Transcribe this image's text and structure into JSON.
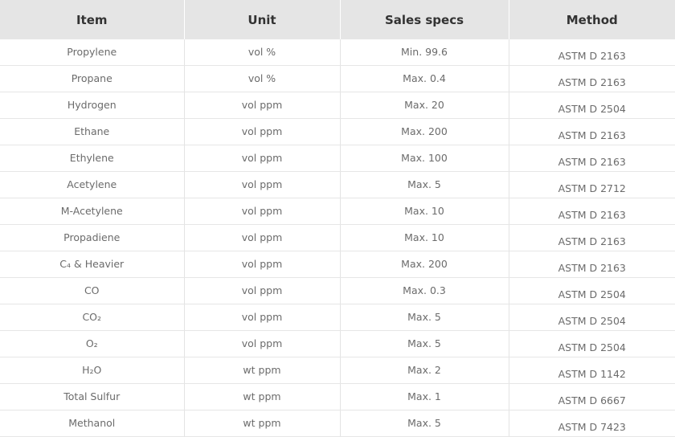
{
  "table": {
    "headers": [
      "Item",
      "Unit",
      "Sales specs",
      "Method"
    ],
    "rows": [
      {
        "item": "Propylene",
        "unit": "vol %",
        "spec": "Min. 99.6",
        "method": "ASTM D 2163"
      },
      {
        "item": "Propane",
        "unit": "vol %",
        "spec": "Max. 0.4",
        "method": "ASTM D 2163"
      },
      {
        "item": "Hydrogen",
        "unit": "vol ppm",
        "spec": "Max. 20",
        "method": "ASTM D 2504"
      },
      {
        "item": "Ethane",
        "unit": "vol ppm",
        "spec": "Max. 200",
        "method": "ASTM D 2163"
      },
      {
        "item": "Ethylene",
        "unit": "vol ppm",
        "spec": "Max. 100",
        "method": "ASTM D 2163"
      },
      {
        "item": "Acetylene",
        "unit": "vol ppm",
        "spec": "Max. 5",
        "method": "ASTM D 2712"
      },
      {
        "item": "M-Acetylene",
        "unit": "vol ppm",
        "spec": "Max. 10",
        "method": "ASTM D 2163"
      },
      {
        "item": "Propadiene",
        "unit": "vol ppm",
        "spec": "Max. 10",
        "method": "ASTM D 2163"
      },
      {
        "item": "C₄ & Heavier",
        "unit": "vol ppm",
        "spec": "Max. 200",
        "method": "ASTM D 2163"
      },
      {
        "item": "CO",
        "unit": "vol ppm",
        "spec": "Max. 0.3",
        "method": "ASTM D 2504"
      },
      {
        "item": "CO₂",
        "unit": "vol ppm",
        "spec": "Max. 5",
        "method": "ASTM D 2504"
      },
      {
        "item": "O₂",
        "unit": "vol ppm",
        "spec": "Max. 5",
        "method": "ASTM D 2504"
      },
      {
        "item": "H₂O",
        "unit": "wt ppm",
        "spec": "Max. 2",
        "method": "ASTM D 1142"
      },
      {
        "item": "Total Sulfur",
        "unit": "wt ppm",
        "spec": "Max. 1",
        "method": "ASTM D 6667"
      },
      {
        "item": "Methanol",
        "unit": "wt ppm",
        "spec": "Max. 5",
        "method": "ASTM D 7423"
      }
    ]
  }
}
